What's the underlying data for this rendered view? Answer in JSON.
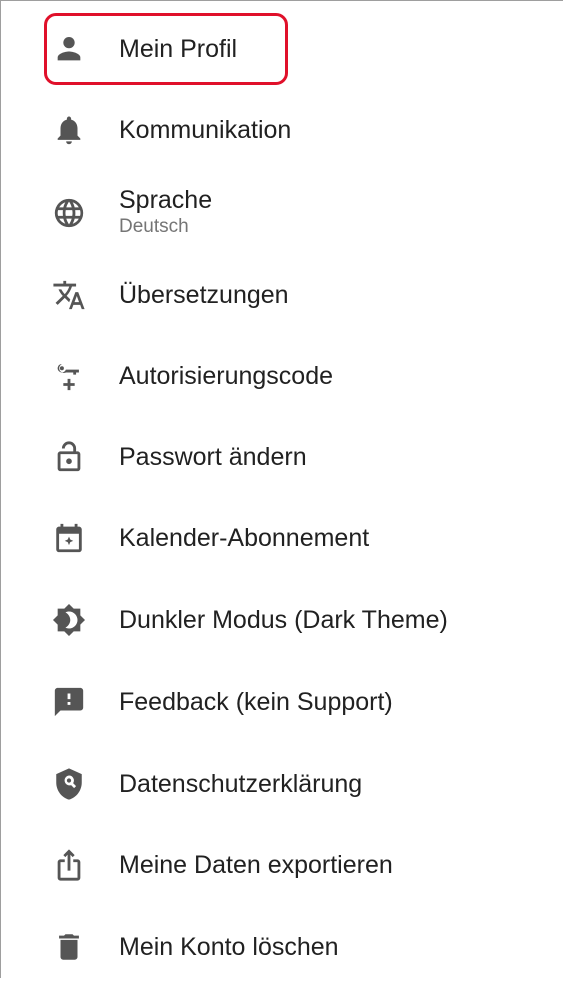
{
  "menu": {
    "items": [
      {
        "label": "Mein Profil",
        "icon": "person-icon"
      },
      {
        "label": "Kommunikation",
        "icon": "bell-icon"
      },
      {
        "label": "Sprache",
        "sub": "Deutsch",
        "icon": "globe-icon"
      },
      {
        "label": "Übersetzungen",
        "icon": "translate-icon"
      },
      {
        "label": "Autorisierungscode",
        "icon": "key-icon"
      },
      {
        "label": "Passwort ändern",
        "icon": "lock-open-icon"
      },
      {
        "label": "Kalender-Abonnement",
        "icon": "calendar-icon"
      },
      {
        "label": "Dunkler Modus (Dark Theme)",
        "icon": "brightness-icon"
      },
      {
        "label": "Feedback (kein Support)",
        "icon": "feedback-icon"
      },
      {
        "label": "Datenschutzerklärung",
        "icon": "privacy-shield-icon"
      },
      {
        "label": "Meine Daten exportieren",
        "icon": "export-icon"
      },
      {
        "label": "Mein Konto löschen",
        "icon": "trash-icon"
      }
    ]
  },
  "colors": {
    "highlight": "#e0102a",
    "icon": "#555555",
    "text": "#212121",
    "subtext": "#757575"
  }
}
